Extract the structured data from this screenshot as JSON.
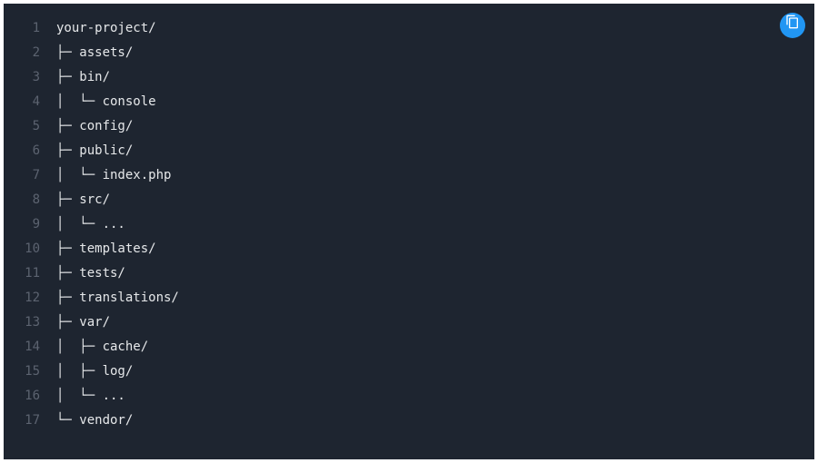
{
  "copyIcon": "copy",
  "lines": [
    {
      "num": "1",
      "text": "your-project/"
    },
    {
      "num": "2",
      "text": "├─ assets/"
    },
    {
      "num": "3",
      "text": "├─ bin/"
    },
    {
      "num": "4",
      "text": "│  └─ console"
    },
    {
      "num": "5",
      "text": "├─ config/"
    },
    {
      "num": "6",
      "text": "├─ public/"
    },
    {
      "num": "7",
      "text": "│  └─ index.php"
    },
    {
      "num": "8",
      "text": "├─ src/"
    },
    {
      "num": "9",
      "text": "│  └─ ..."
    },
    {
      "num": "10",
      "text": "├─ templates/"
    },
    {
      "num": "11",
      "text": "├─ tests/"
    },
    {
      "num": "12",
      "text": "├─ translations/"
    },
    {
      "num": "13",
      "text": "├─ var/"
    },
    {
      "num": "14",
      "text": "│  ├─ cache/"
    },
    {
      "num": "15",
      "text": "│  ├─ log/"
    },
    {
      "num": "16",
      "text": "│  └─ ..."
    },
    {
      "num": "17",
      "text": "└─ vendor/"
    }
  ]
}
